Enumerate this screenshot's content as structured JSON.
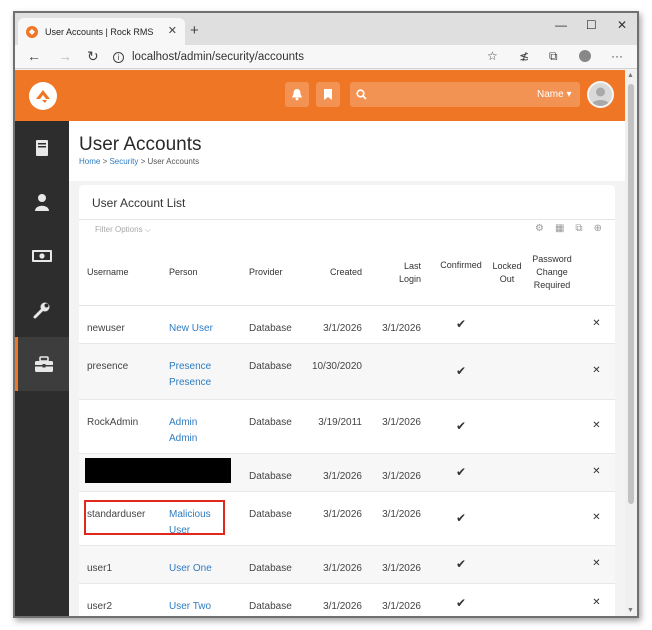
{
  "browser": {
    "tab_title": "User Accounts | Rock RMS",
    "tab_close": "✕",
    "new_tab": "+",
    "minimize": "—",
    "maximize": "☐",
    "close": "✕",
    "url": "localhost/admin/security/accounts",
    "info": "i"
  },
  "header": {
    "name_menu": "Name ▾"
  },
  "page": {
    "title": "User Accounts",
    "breadcrumb": {
      "home": "Home",
      "sep1": " > ",
      "security": "Security",
      "sep2": " > ",
      "current": "User Accounts"
    }
  },
  "panel": {
    "title": "User Account List",
    "filter": "Filter Options ⌵"
  },
  "table": {
    "columns": {
      "username": "Username",
      "person": "Person",
      "provider": "Provider",
      "created": "Created",
      "last_login_1": "Last",
      "last_login_2": "Login",
      "confirmed": "Confirmed",
      "locked_1": "Locked",
      "locked_2": "Out",
      "pw_1": "Password",
      "pw_2": "Change",
      "pw_3": "Required"
    },
    "rows": [
      {
        "username": "newuser",
        "person_1": "New User",
        "person_2": "",
        "provider": "Database",
        "created": "3/1/2026",
        "last_login": "3/1/2026",
        "confirmed": "✔",
        "delete": "✕"
      },
      {
        "username": "presence",
        "person_1": "Presence",
        "person_2": "Presence",
        "provider": "Database",
        "created": "10/30/2020",
        "last_login": "",
        "confirmed": "✔",
        "delete": "✕"
      },
      {
        "username": "RockAdmin",
        "person_1": "Admin",
        "person_2": "Admin",
        "provider": "Database",
        "created": "3/19/2011",
        "last_login": "3/1/2026",
        "confirmed": "✔",
        "delete": "✕"
      },
      {
        "username": "",
        "person_1": "",
        "person_2": "",
        "provider": "Database",
        "created": "3/1/2026",
        "last_login": "3/1/2026",
        "confirmed": "✔",
        "delete": "✕"
      },
      {
        "username": "standarduser",
        "person_1": "Malicious",
        "person_2": "User",
        "provider": "Database",
        "created": "3/1/2026",
        "last_login": "3/1/2026",
        "confirmed": "✔",
        "delete": "✕"
      },
      {
        "username": "user1",
        "person_1": "User One",
        "person_2": "",
        "provider": "Database",
        "created": "3/1/2026",
        "last_login": "3/1/2026",
        "confirmed": "✔",
        "delete": "✕"
      },
      {
        "username": "user2",
        "person_1": "User Two",
        "person_2": "",
        "provider": "Database",
        "created": "3/1/2026",
        "last_login": "3/1/2026",
        "confirmed": "✔",
        "delete": "✕"
      }
    ]
  },
  "colors": {
    "brand": "#ee7625",
    "sidebar": "#2d2d2d",
    "link": "#2f7cc1",
    "highlight": "#e0281c"
  }
}
